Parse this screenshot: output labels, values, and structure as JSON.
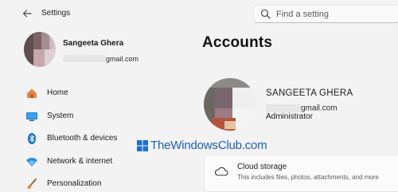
{
  "app": {
    "title": "Settings"
  },
  "search": {
    "placeholder": "Find a setting",
    "value": ""
  },
  "user": {
    "name": "Sangeeta Ghera",
    "email_visible": "gmail.com"
  },
  "nav": {
    "items": [
      {
        "label": "Home",
        "icon": "home-icon"
      },
      {
        "label": "System",
        "icon": "system-icon"
      },
      {
        "label": "Bluetooth & devices",
        "icon": "bluetooth-icon"
      },
      {
        "label": "Network & internet",
        "icon": "network-icon"
      },
      {
        "label": "Personalization",
        "icon": "personalization-icon"
      }
    ]
  },
  "main": {
    "title": "Accounts",
    "account": {
      "name": "SANGEETA GHERA",
      "email_visible": "gmail.com",
      "role": "Administrator"
    },
    "cloud": {
      "title": "Cloud storage",
      "description": "This includes files, photos, attachments, and more"
    }
  },
  "watermark": {
    "text": "TheWindowsClub.com"
  },
  "colors": {
    "accent": "#0067c0",
    "watermark": "#1b5fb3",
    "background": "#f3f3f3"
  }
}
